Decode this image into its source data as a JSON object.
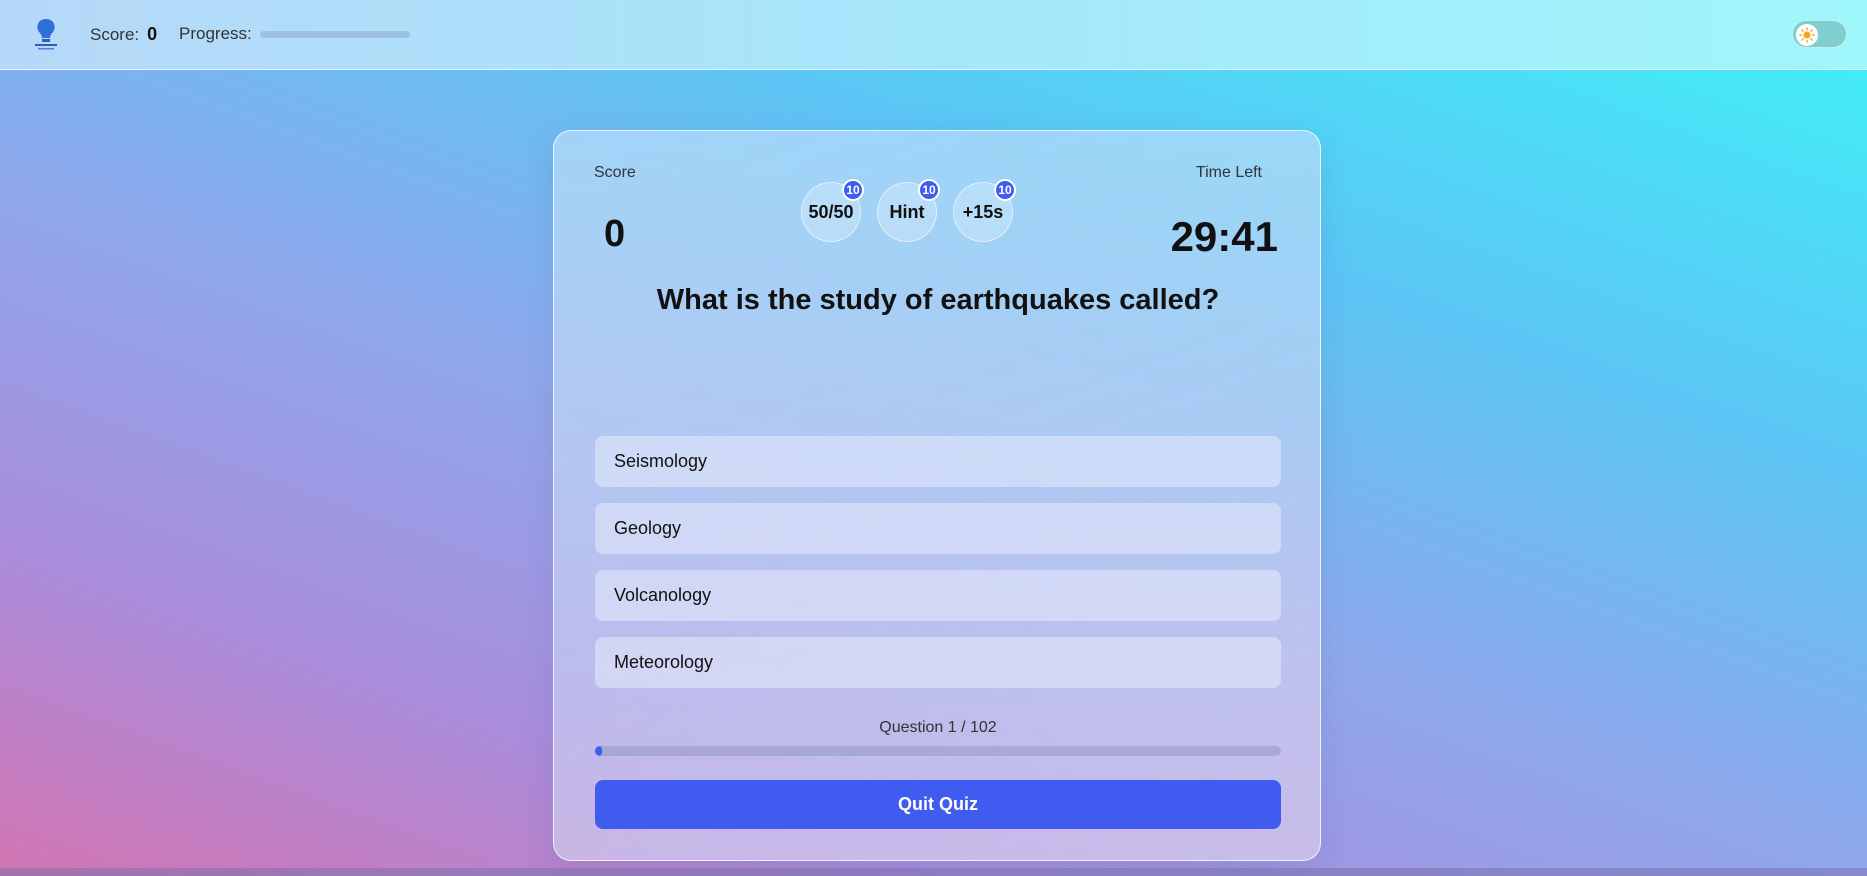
{
  "topbar": {
    "logo_icon": "lightbulb-logo-icon",
    "score_label": "Score:",
    "score_value": "0",
    "progress_label": "Progress:",
    "progress_fraction": 0.0,
    "theme_toggle_icon": "sun-icon"
  },
  "card": {
    "score_label": "Score",
    "score_value": "0",
    "time_label": "Time Left",
    "time_value": "29:41",
    "lifelines": [
      {
        "label": "50/50",
        "count": "10"
      },
      {
        "label": "Hint",
        "count": "10"
      },
      {
        "label": "+15s",
        "count": "10"
      }
    ],
    "question": "What is the study of earthquakes called?",
    "options": [
      "Seismology",
      "Geology",
      "Volcanology",
      "Meteorology"
    ],
    "question_counter": "Question 1 / 102",
    "question_progress_fraction": 0.0098,
    "quit_label": "Quit Quiz"
  },
  "colors": {
    "accent": "#3f5bf0",
    "toggle_track": "#7fcfd0"
  }
}
